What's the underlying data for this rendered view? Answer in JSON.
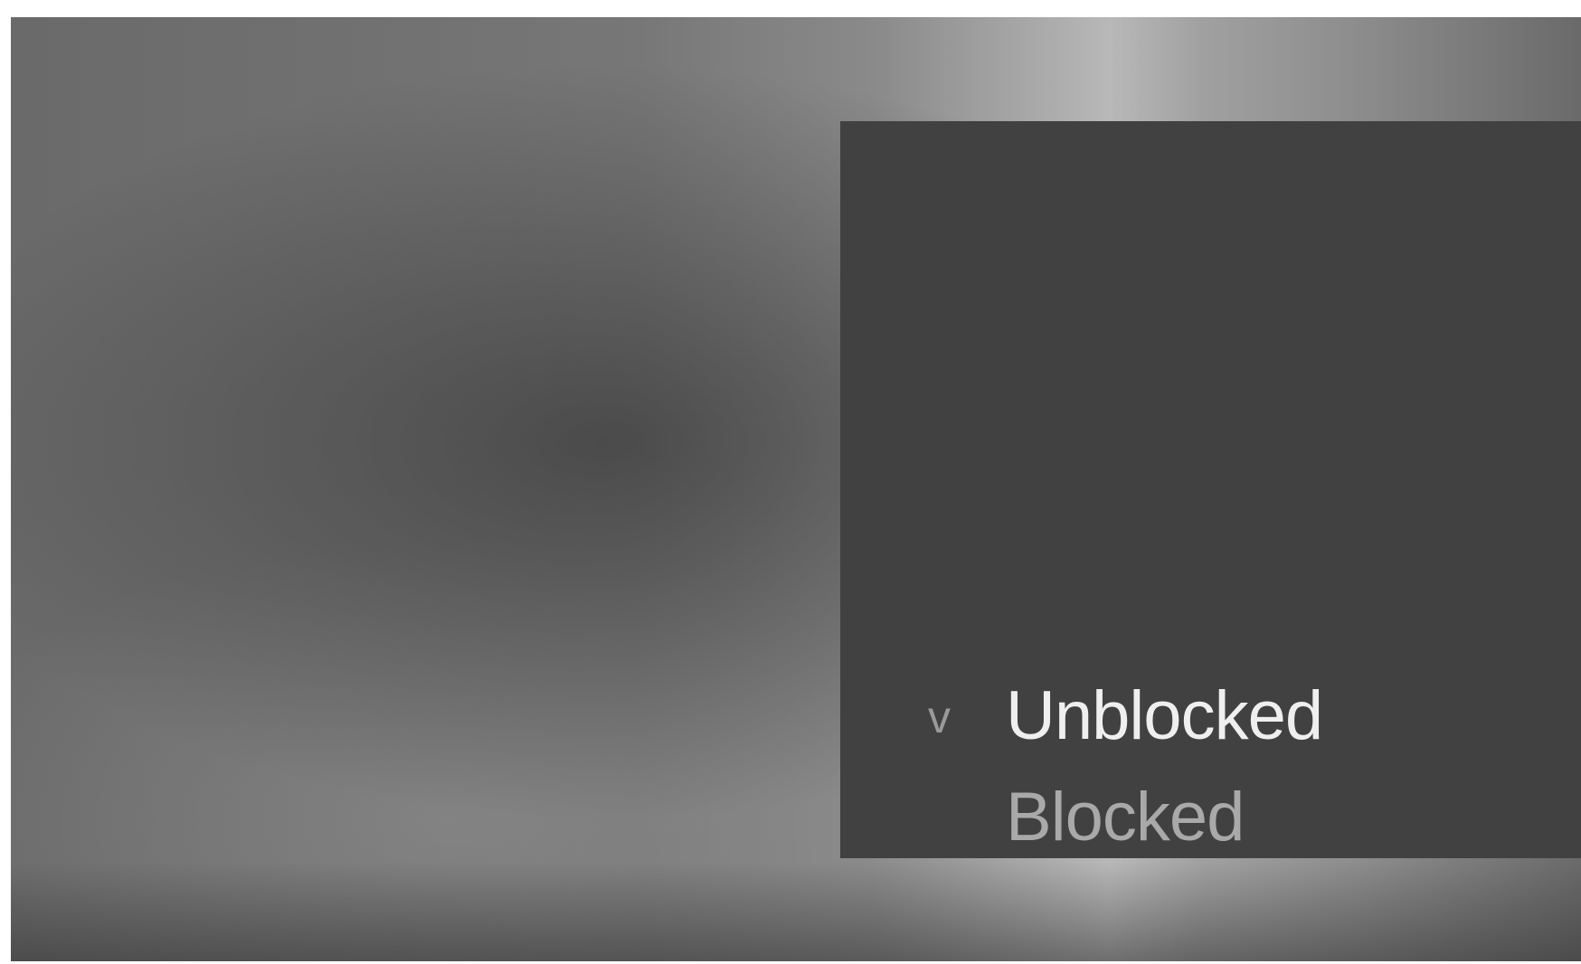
{
  "menu": {
    "items": [
      {
        "label": "Unblocked",
        "check": "v",
        "selected": true
      },
      {
        "label": "Blocked",
        "check": "",
        "selected": false
      }
    ]
  },
  "colors": {
    "panel_background": "#414141",
    "selected_text": "#efefef",
    "unselected_text": "#a9a9a9",
    "check_mark": "#9a9a9a"
  }
}
